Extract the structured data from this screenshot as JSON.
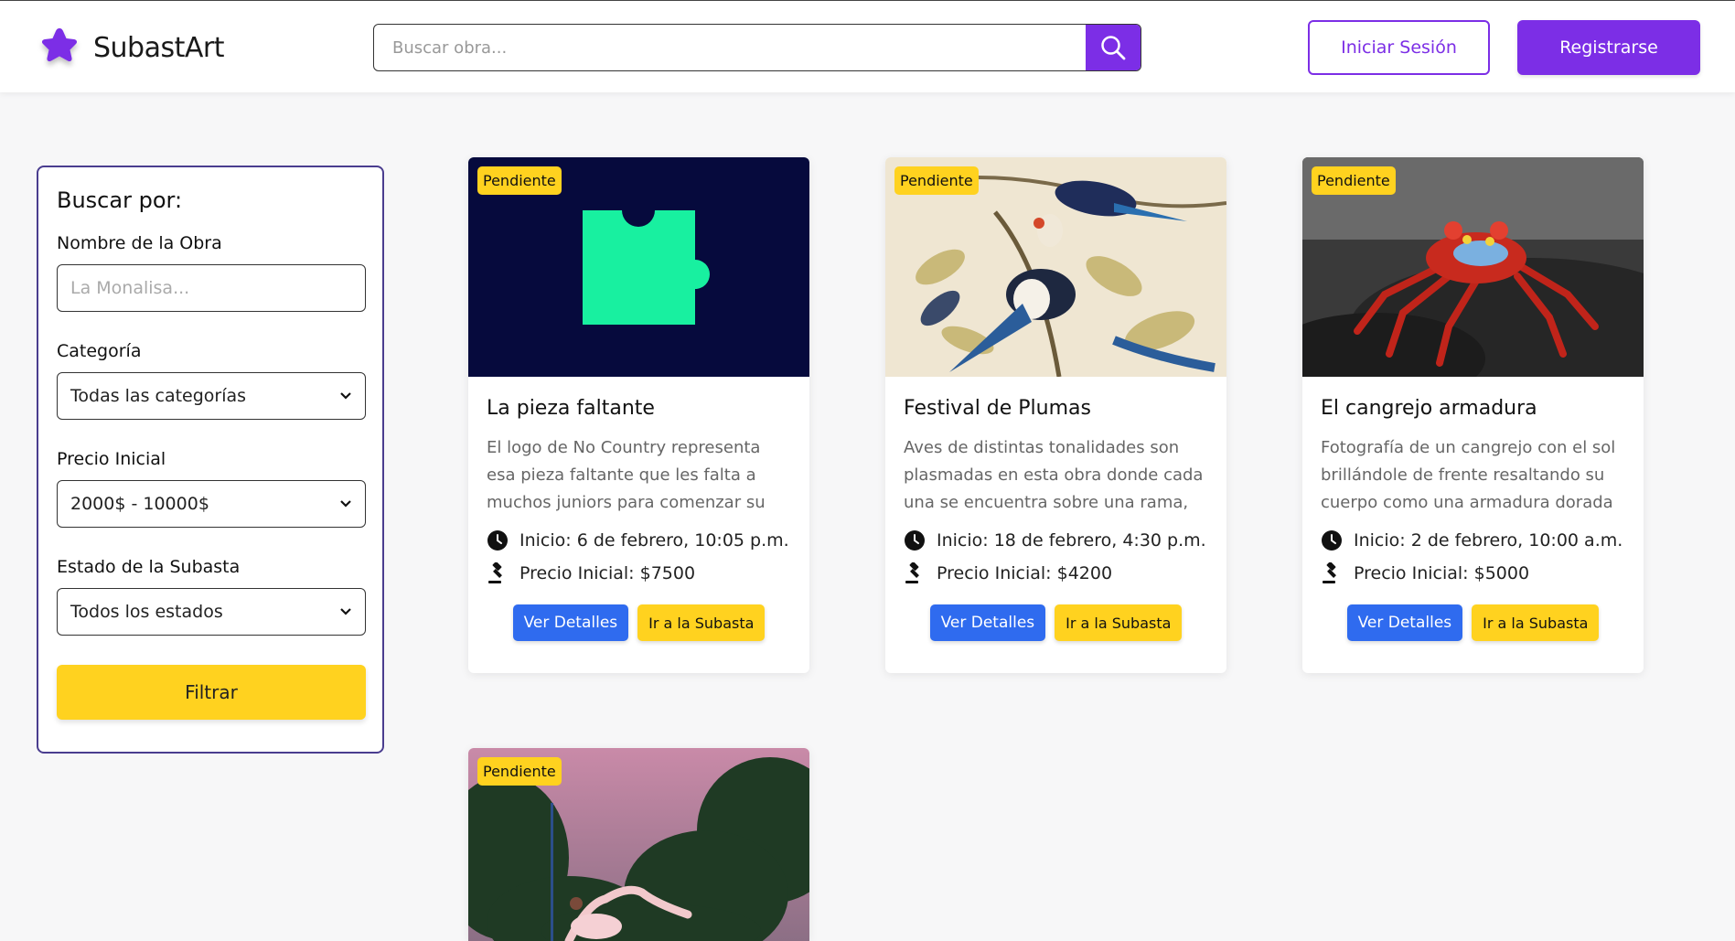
{
  "app": {
    "name": "SubastArt",
    "brand_color": "#7c2ee6",
    "accent_yellow": "#ffd21f",
    "button_blue": "#2f6bef"
  },
  "header": {
    "search_placeholder": "Buscar obra...",
    "login_label": "Iniciar Sesión",
    "register_label": "Registrarse"
  },
  "filter": {
    "title": "Buscar por:",
    "name_label": "Nombre de la Obra",
    "name_placeholder": "La Monalisa...",
    "category_label": "Categoría",
    "category_value": "Todas las categorías",
    "price_label": "Precio Inicial",
    "price_value": "2000$ - 10000$",
    "status_label": "Estado de la Subasta",
    "status_value": "Todos los estados",
    "button_label": "Filtrar"
  },
  "cards": [
    {
      "badge": "Pendiente",
      "image": "puzzle-piece-logo",
      "title": "La pieza faltante",
      "description": "El logo de No Country representa esa pieza faltante que les falta a muchos juniors para comenzar su travesía labor...",
      "start": "Inicio: 6 de febrero, 10:05 p.m.",
      "price": "Precio Inicial: $7500",
      "details_label": "Ver Detalles",
      "auction_label": "Ir a la Subasta"
    },
    {
      "badge": "Pendiente",
      "image": "birds-illustration",
      "title": "Festival de Plumas",
      "description": "Aves de distintas tonalidades son plasmadas en esta obra donde cada una se encuentra sobre una rama, pero tienen...",
      "start": "Inicio: 18 de febrero, 4:30 p.m.",
      "price": "Precio Inicial: $4200",
      "details_label": "Ver Detalles",
      "auction_label": "Ir a la Subasta"
    },
    {
      "badge": "Pendiente",
      "image": "crab-photo",
      "title": "El cangrejo armadura",
      "description": "Fotografía de un cangrejo con el sol brillándole de frente resaltando su cuerpo como una armadura dorada",
      "start": "Inicio: 2 de febrero, 10:00 a.m.",
      "price": "Precio Inicial: $5000",
      "details_label": "Ver Detalles",
      "auction_label": "Ir a la Subasta"
    },
    {
      "badge": "Pendiente",
      "image": "dancer-photo"
    }
  ]
}
